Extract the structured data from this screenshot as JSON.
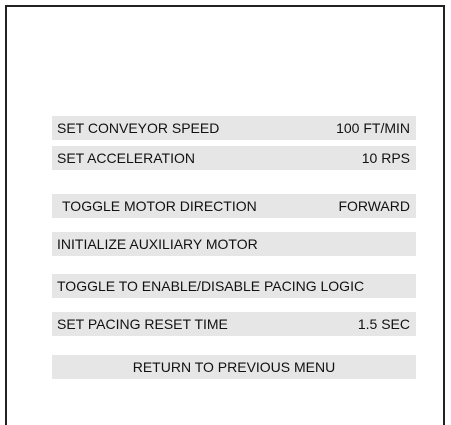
{
  "menu": {
    "items": [
      {
        "label": "SET CONVEYOR SPEED",
        "value": "100 FT/MIN"
      },
      {
        "label": "SET ACCELERATION",
        "value": "10 RPS"
      },
      {
        "label": "TOGGLE MOTOR DIRECTION",
        "value": "FORWARD"
      },
      {
        "label": "INITIALIZE AUXILIARY MOTOR",
        "value": ""
      },
      {
        "label": "TOGGLE TO ENABLE/DISABLE PACING LOGIC",
        "value": ""
      },
      {
        "label": "SET PACING RESET TIME",
        "value": "1.5 SEC"
      },
      {
        "label": "RETURN TO PREVIOUS MENU",
        "value": ""
      }
    ]
  }
}
